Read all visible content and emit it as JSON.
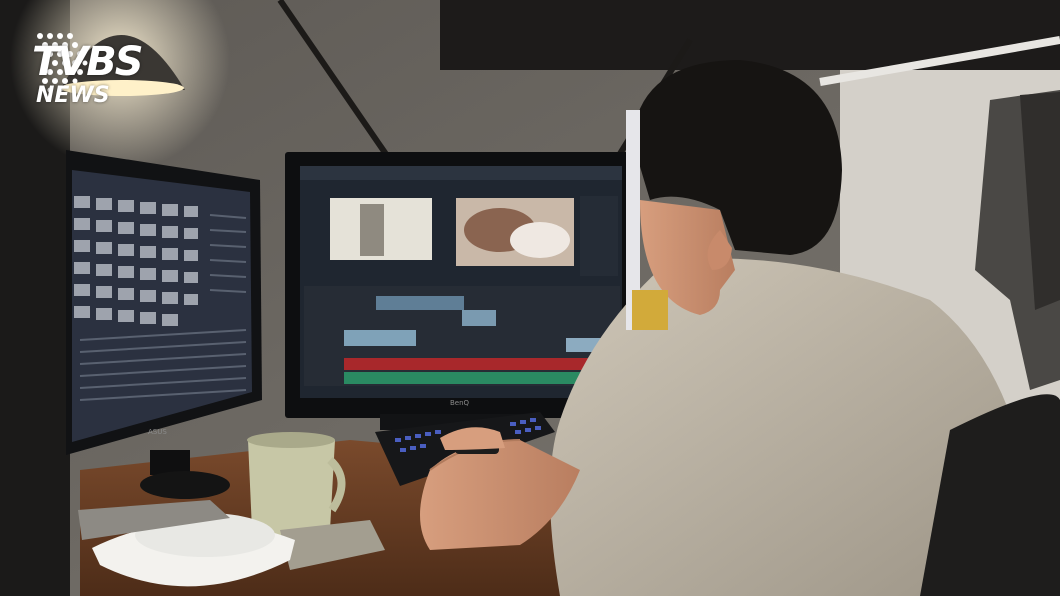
{
  "watermark": {
    "brand_main": "TVBS",
    "brand_sub": "NEWS"
  },
  "monitor_brands": {
    "left": "ASUS",
    "center": "BenQ"
  },
  "icons": {
    "logo_dots": "dot-grid-icon"
  }
}
